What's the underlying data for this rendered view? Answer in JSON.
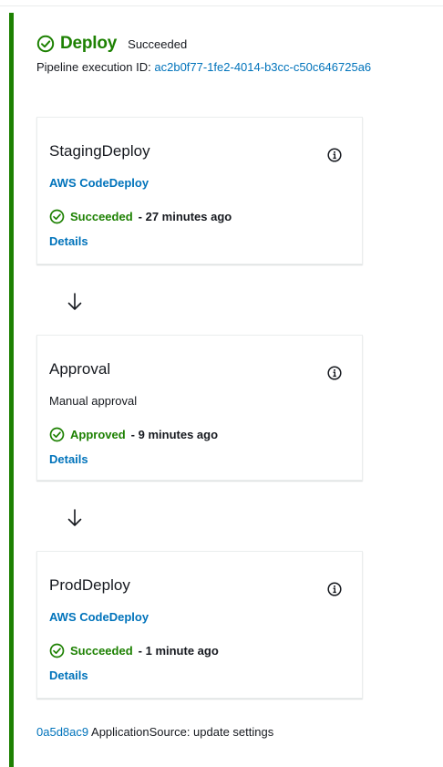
{
  "stage": {
    "title": "Deploy",
    "status": "Succeeded",
    "execution_label": "Pipeline execution ID:",
    "execution_id": "ac2b0f77-1fe2-4014-b3cc-c50c646725a6",
    "icon": "check-circle-icon"
  },
  "actions": [
    {
      "name": "StagingDeploy",
      "provider": "AWS CodeDeploy",
      "status": "Succeeded",
      "time": "- 27 minutes ago",
      "details": "Details"
    },
    {
      "name": "Approval",
      "provider": "Manual approval",
      "status": "Approved",
      "time": "- 9 minutes ago",
      "details": "Details"
    },
    {
      "name": "ProdDeploy",
      "provider": "AWS CodeDeploy",
      "status": "Succeeded",
      "time": "- 1 minute ago",
      "details": "Details"
    }
  ],
  "footer": {
    "commit_id": "0a5d8ac9",
    "commit_message": "ApplicationSource: update settings"
  },
  "colors": {
    "success": "#1d8102",
    "link": "#0073bb",
    "text": "#16191f",
    "border": "#eaeded"
  }
}
